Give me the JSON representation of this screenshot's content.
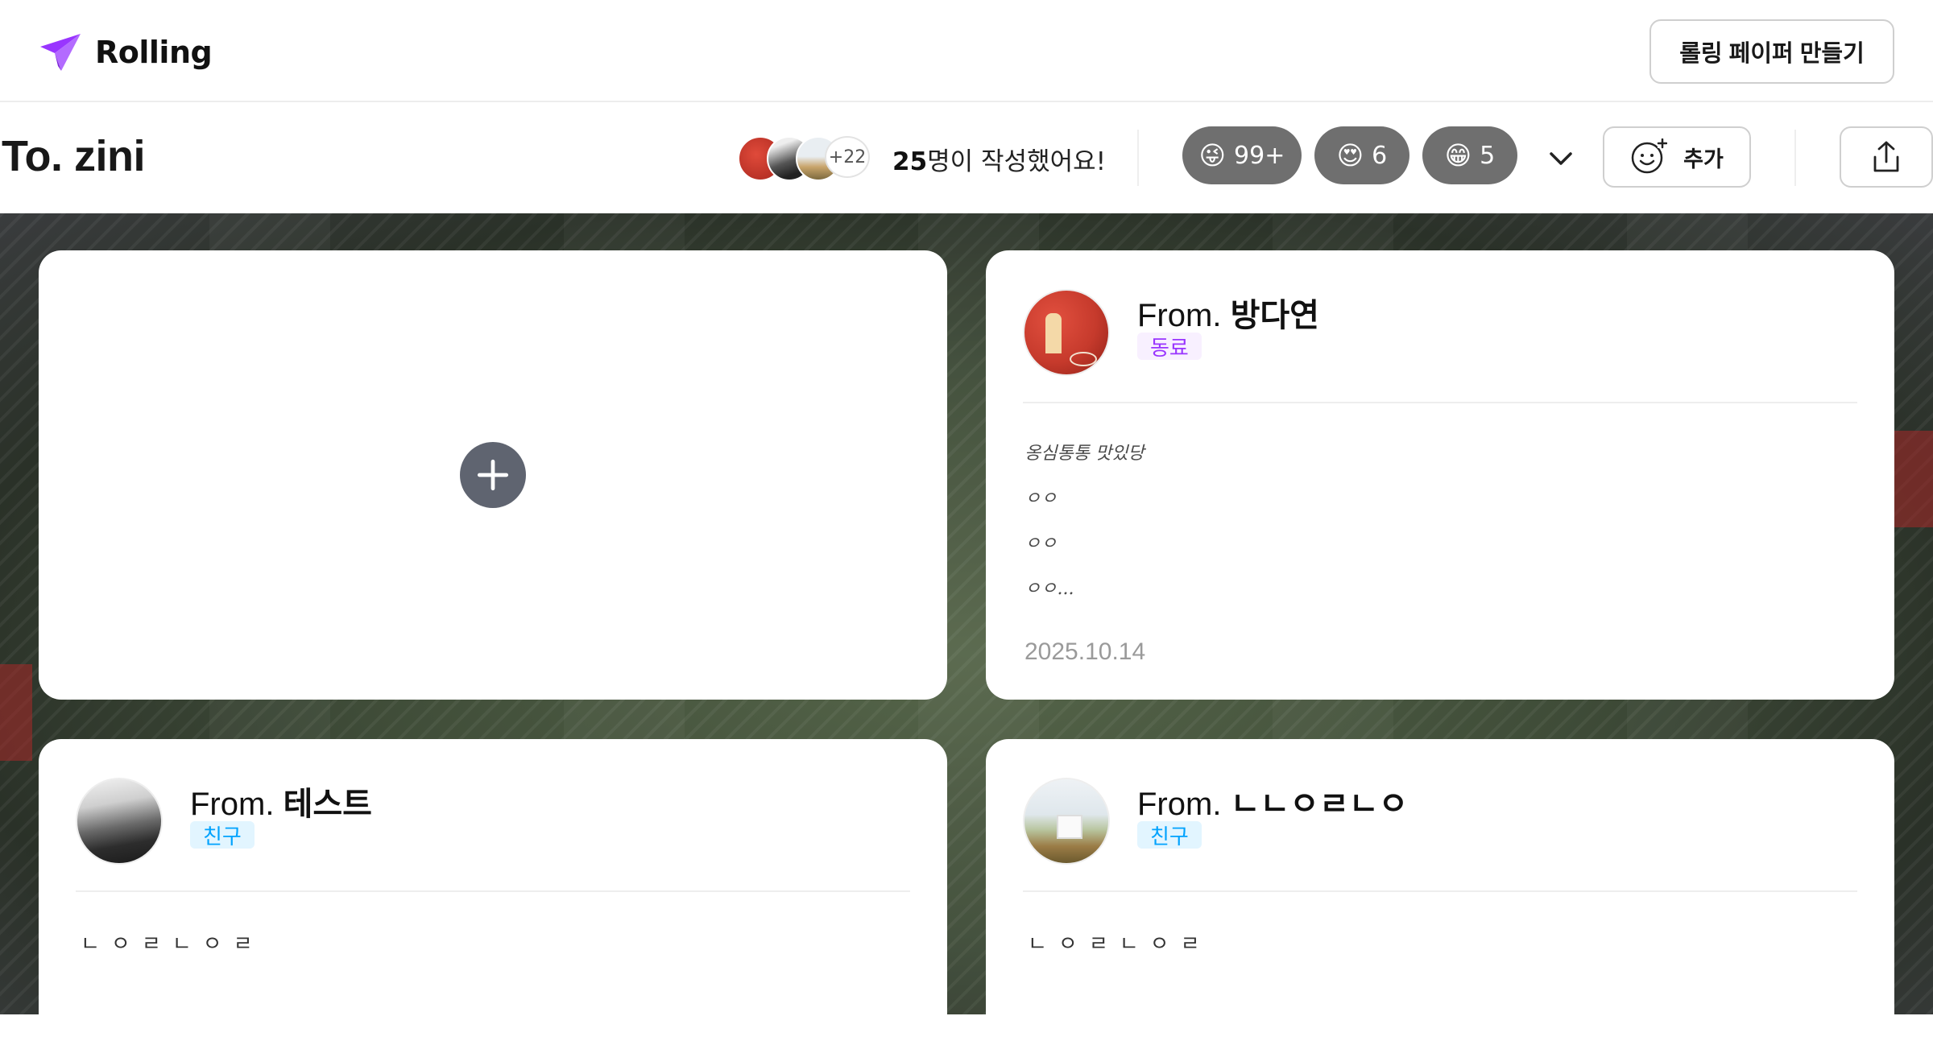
{
  "brand": {
    "name": "Rolling",
    "accent": "#9935ff"
  },
  "nav": {
    "create_label": "롤링 페이퍼 만들기"
  },
  "header": {
    "title": "To. zini",
    "avatar_more": "+22",
    "writer_count_number": "25",
    "writer_count_suffix": "명이 작성했어요!",
    "reactions": [
      {
        "emoji": "😜",
        "count": "99+"
      },
      {
        "emoji": "😍",
        "count": "6"
      },
      {
        "emoji": "😁",
        "count": "5"
      }
    ],
    "add_label": "추가",
    "icons": {
      "dropdown": "chevron-down-icon",
      "add": "add-emoji-icon",
      "share": "share-icon"
    }
  },
  "messages": [
    {
      "from_prefix": "From.",
      "sender": "방다연",
      "relation": "동료",
      "lines": [
        "옹심통통 맛있당",
        "ㅇㅇ",
        "ㅇㅇ",
        "ㅇㅇ..."
      ],
      "date": "2025.10.14"
    },
    {
      "from_prefix": "From.",
      "sender": "테스트",
      "relation": "친구",
      "lines": [
        "ㄴㅇㄹㄴㅇㄹ"
      ]
    },
    {
      "from_prefix": "From.",
      "sender": "ㄴㄴㅇㄹㄴㅇ",
      "relation": "친구",
      "lines": [
        "ㄴㅇㄹㄴㅇㄹ"
      ]
    }
  ]
}
